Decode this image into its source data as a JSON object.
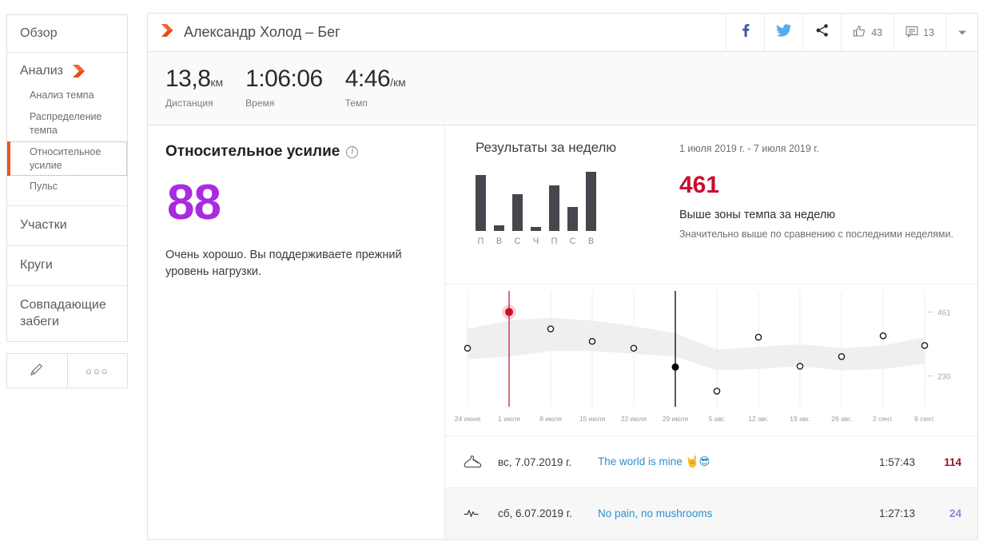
{
  "sidebar": {
    "overview_label": "Обзор",
    "analysis_label": "Анализ",
    "sub_items": [
      {
        "label": "Анализ темпа",
        "active": false
      },
      {
        "label": "Распределение темпа",
        "active": false
      },
      {
        "label": "Относительное усилие",
        "active": true
      },
      {
        "label": "Пульс",
        "active": false
      }
    ],
    "sections": [
      {
        "label": "Участки"
      },
      {
        "label": "Круги"
      },
      {
        "label": "Совпадающие забеги"
      }
    ],
    "tools": {
      "edit_icon": "pencil-icon",
      "more_label": "○○○"
    }
  },
  "header": {
    "logo_icon": "strava-chevron-icon",
    "title": "Александр Холод – Бег",
    "facebook_icon": "facebook-icon",
    "twitter_icon": "twitter-icon",
    "share_icon": "share-icon",
    "kudos_icon": "thumbs-up-icon",
    "kudos_count": "43",
    "comments_icon": "comment-icon",
    "comments_count": "13",
    "caret_icon": "chevron-down-icon"
  },
  "stats": [
    {
      "value": "13,8",
      "unit": "км",
      "label": "Дистанция"
    },
    {
      "value": "1:06:06",
      "unit": "",
      "label": "Время"
    },
    {
      "value": "4:46",
      "unit": "/км",
      "label": "Темп"
    }
  ],
  "relative_effort": {
    "title": "Относительное усилие",
    "info_icon": "info-circle-icon",
    "score": "88",
    "score_color": "#a92be0",
    "description": "Очень хорошо. Вы поддерживаете прежний уровень нагрузки."
  },
  "week": {
    "title": "Результаты за неделю",
    "range": "1 июля 2019 г. - 7 июля 2019 г.",
    "score": "461",
    "score_color": "#c8102e",
    "headline": "Выше зоны темпа за неделю",
    "subtext": "Значительно выше по сравнению с последними неделями."
  },
  "chart_data": [
    {
      "type": "bar",
      "title": "Результаты за неделю",
      "categories": [
        "П",
        "В",
        "С",
        "Ч",
        "П",
        "С",
        "В"
      ],
      "values": [
        74,
        7,
        48,
        5,
        60,
        32,
        78
      ],
      "ylim": [
        0,
        80
      ],
      "grid": false,
      "bar_color": "#46464d",
      "xlabel": "",
      "ylabel": ""
    },
    {
      "type": "scatter",
      "title": "Относительное усилие по неделям",
      "xlabel": "",
      "ylabel": "",
      "x": [
        "24 июня",
        "1 июля",
        "8 июля",
        "15 июля",
        "22 июля",
        "29 июля",
        "5 авг.",
        "12 авг.",
        "19 авг.",
        "26 авг.",
        "2 сент.",
        "9 сент."
      ],
      "values": [
        330,
        461,
        400,
        355,
        330,
        262,
        175,
        370,
        265,
        300,
        375,
        340
      ],
      "ylim": [
        130,
        520
      ],
      "yticks": [
        230,
        461
      ],
      "ytick_labels": [
        "230",
        "461"
      ],
      "grid": true,
      "highlight_index": 1,
      "highlight_color": "#c8102e",
      "selected_index": 5,
      "selected_color": "#000000",
      "band_color": "#efefef",
      "band_upper": [
        400,
        430,
        440,
        430,
        410,
        385,
        325,
        335,
        345,
        330,
        340,
        370
      ],
      "band_lower": [
        290,
        300,
        320,
        320,
        310,
        300,
        250,
        255,
        265,
        250,
        255,
        275
      ],
      "legend": ""
    }
  ],
  "activities": {
    "columns": [
      "icon",
      "date",
      "name",
      "time",
      "score"
    ],
    "rows": [
      {
        "icon": "running-shoe-icon",
        "date": "вс, 7.07.2019 г.",
        "name": "The world is mine 🤘😎",
        "time": "1:57:43",
        "score": "114",
        "score_color": "#a01020"
      },
      {
        "icon": "heart-rate-icon",
        "date": "сб, 6.07.2019 г.",
        "name": "No pain, no mushrooms",
        "time": "1:27:13",
        "score": "24",
        "score_color": "#9a7fd8"
      }
    ]
  }
}
